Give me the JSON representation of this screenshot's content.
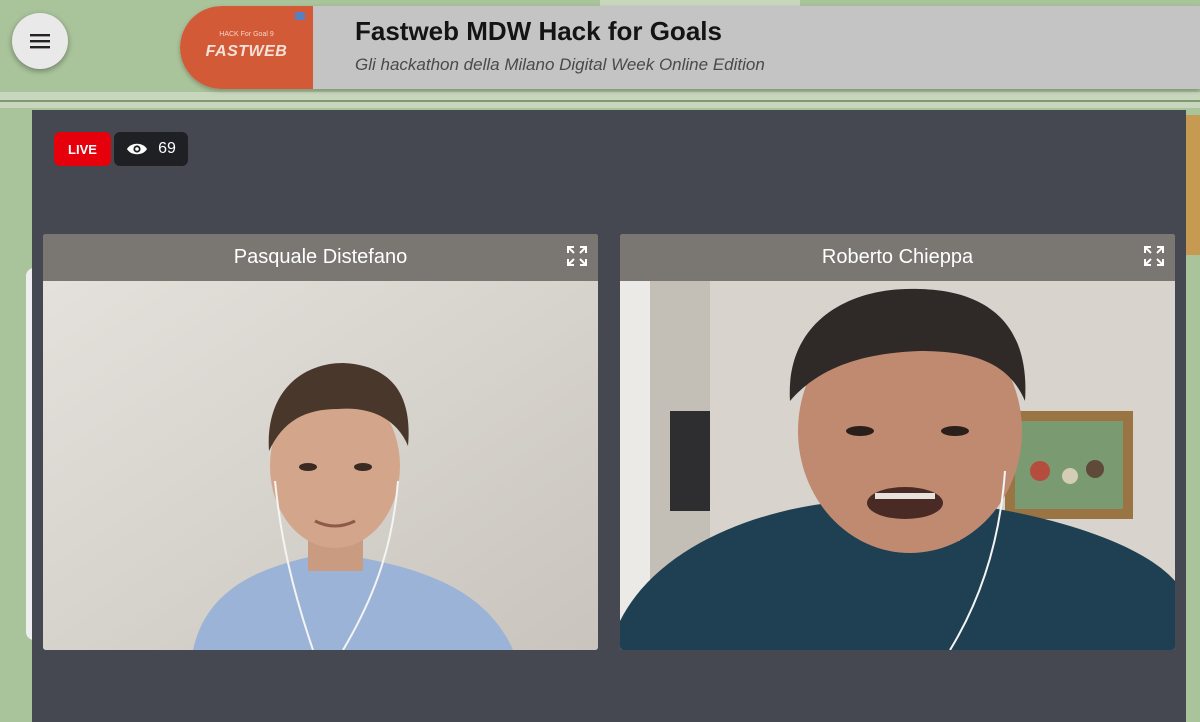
{
  "header": {
    "logo_top_text": "HACK For Goal 9",
    "logo_text": "FASTWEB",
    "title": "Fastweb MDW Hack for Goals",
    "subtitle": "Gli hackathon della Milano Digital Week Online Edition"
  },
  "menu": {
    "icon": "hamburger-menu-icon"
  },
  "stream": {
    "live_label": "LIVE",
    "viewer_icon": "eye-icon",
    "viewer_count": "69"
  },
  "participants": [
    {
      "name": "Pasquale Distefano",
      "expand_icon": "fullscreen-icon"
    },
    {
      "name": "Roberto Chieppa",
      "expand_icon": "fullscreen-icon"
    }
  ],
  "colors": {
    "live": "#e5000b",
    "stage": "#464851",
    "logo_bg": "#d35a37",
    "header_bg": "#c4c4c4"
  }
}
